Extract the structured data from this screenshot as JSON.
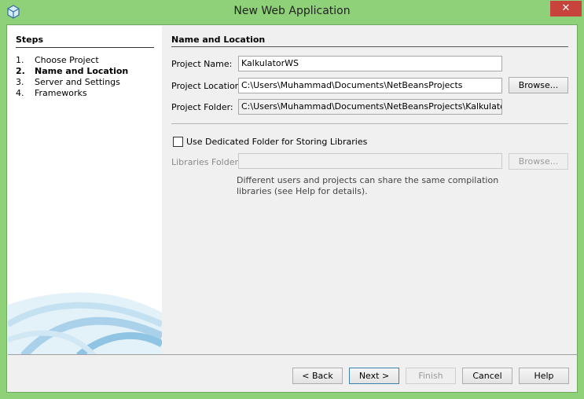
{
  "window": {
    "title": "New Web Application",
    "close_glyph": "✕",
    "accent_color": "#8fd179",
    "close_color": "#c7433b"
  },
  "steps": {
    "title": "Steps",
    "items": [
      {
        "num": "1.",
        "label": "Choose Project"
      },
      {
        "num": "2.",
        "label": "Name and Location"
      },
      {
        "num": "3.",
        "label": "Server and Settings"
      },
      {
        "num": "4.",
        "label": "Frameworks"
      }
    ]
  },
  "form": {
    "section_title": "Name and Location",
    "project_name": {
      "label": "Project Name:",
      "value": "KalkulatorWS"
    },
    "project_location": {
      "label": "Project Location:",
      "value": "C:\\Users\\Muhammad\\Documents\\NetBeansProjects",
      "browse": "Browse..."
    },
    "project_folder": {
      "label": "Project Folder:",
      "value": "C:\\Users\\Muhammad\\Documents\\NetBeansProjects\\KalkulatorWS"
    },
    "dedicated_folder": {
      "label": "Use Dedicated Folder for Storing Libraries",
      "checked": false
    },
    "libraries_folder": {
      "label": "Libraries Folder:",
      "value": "",
      "browse": "Browse..."
    },
    "hint": "Different users and projects can share the same compilation libraries (see Help for details)."
  },
  "buttons": {
    "back": "< Back",
    "next": "Next >",
    "finish": "Finish",
    "cancel": "Cancel",
    "help": "Help"
  }
}
